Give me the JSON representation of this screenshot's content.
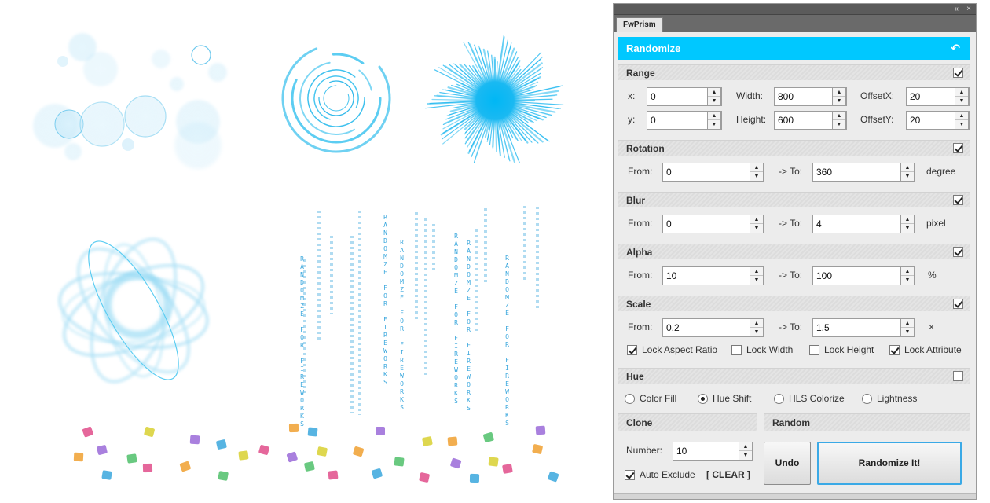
{
  "panel": {
    "title_controls": [
      "«",
      "×"
    ],
    "tab_label": "FwPrism",
    "header": {
      "title": "Randomize",
      "undo_icon": "undo-arrow-icon"
    }
  },
  "range": {
    "title": "Range",
    "checked": true,
    "x_label": "x:",
    "x_value": "0",
    "y_label": "y:",
    "y_value": "0",
    "width_label": "Width:",
    "width_value": "800",
    "height_label": "Height:",
    "height_value": "600",
    "offsetx_label": "OffsetX:",
    "offsetx_value": "20",
    "offsety_label": "OffsetY:",
    "offsety_value": "20"
  },
  "rotation": {
    "title": "Rotation",
    "checked": true,
    "from_label": "From:",
    "from_value": "0",
    "to_label": "-> To:",
    "to_value": "360",
    "unit": "degree"
  },
  "blur": {
    "title": "Blur",
    "checked": true,
    "from_label": "From:",
    "from_value": "0",
    "to_label": "-> To:",
    "to_value": "4",
    "unit": "pixel"
  },
  "alpha": {
    "title": "Alpha",
    "checked": true,
    "from_label": "From:",
    "from_value": "10",
    "to_label": "-> To:",
    "to_value": "100",
    "unit": "%"
  },
  "scale": {
    "title": "Scale",
    "checked": true,
    "from_label": "From:",
    "from_value": "0.2",
    "to_label": "-> To:",
    "to_value": "1.5",
    "unit": "×",
    "options": [
      {
        "label": "Lock Aspect Ratio",
        "checked": true
      },
      {
        "label": "Lock Width",
        "checked": false
      },
      {
        "label": "Lock Height",
        "checked": false
      },
      {
        "label": "Lock Attribute",
        "checked": true
      }
    ]
  },
  "hue": {
    "title": "Hue",
    "checked": false,
    "modes": [
      {
        "label": "Color Fill",
        "selected": false
      },
      {
        "label": "Hue Shift",
        "selected": true
      },
      {
        "label": "HLS Colorize",
        "selected": false
      },
      {
        "label": "Lightness",
        "selected": false
      }
    ]
  },
  "clone": {
    "title": "Clone",
    "number_label": "Number:",
    "number_value": "10",
    "auto_exclude_label": "Auto Exclude",
    "auto_exclude_checked": true,
    "clear_label": "[ CLEAR ]"
  },
  "random": {
    "title": "Random",
    "undo_label": "Undo",
    "randomize_label": "Randomize It!"
  },
  "preview": {
    "matrix_text": "RANDOMZE FOR FIREWORKS",
    "accent": "#00c8ff",
    "icon_colors": [
      "#e04c8a",
      "#f0a030",
      "#9a6ad8",
      "#3aa7dd",
      "#4fc06a",
      "#d8d030"
    ]
  }
}
